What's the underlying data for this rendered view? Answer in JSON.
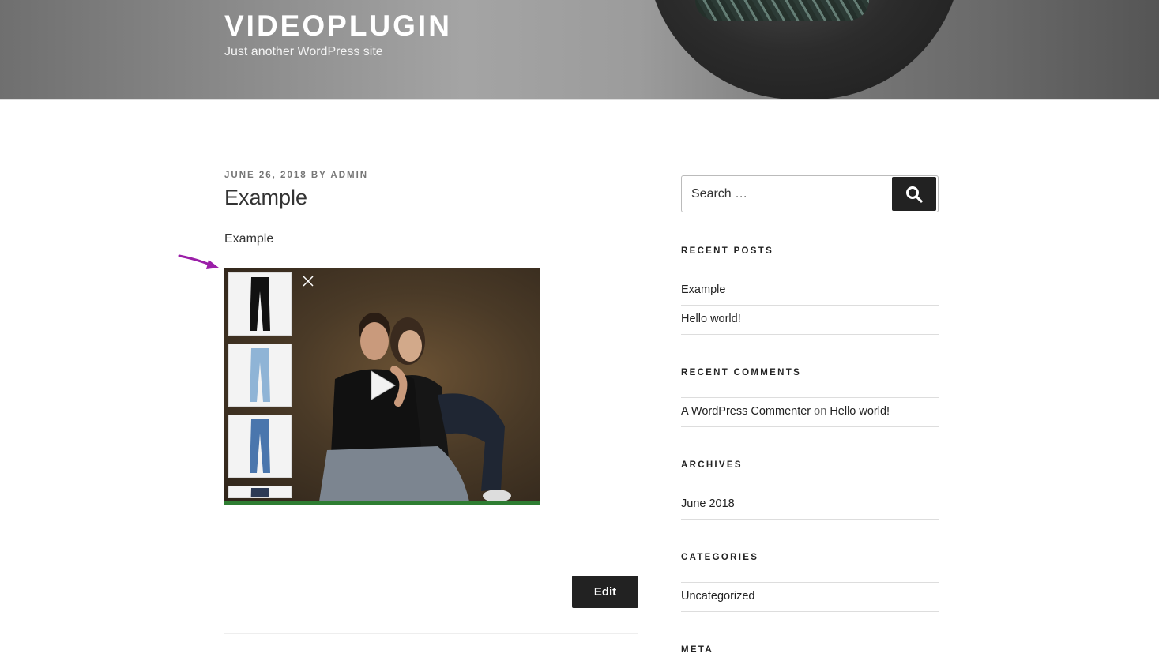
{
  "site": {
    "title": "VIDEOPLUGIN",
    "tagline": "Just another WordPress site"
  },
  "post": {
    "date": "JUNE 26, 2018",
    "by": "BY",
    "author": "ADMIN",
    "title": "Example",
    "content": "Example",
    "edit_label": "Edit",
    "video": {
      "progress_fraction": 1.0,
      "progress_color": "#2e7d32",
      "thumbnails": [
        "black-jeans",
        "light-blue-jeans",
        "medium-blue-jeans",
        "dark-jeans"
      ]
    }
  },
  "annotation": {
    "arrow_color": "#9b1fa8"
  },
  "sidebar": {
    "search": {
      "placeholder": "Search …",
      "button_icon": "search-icon"
    },
    "recent_posts": {
      "title": "RECENT POSTS",
      "items": [
        "Example",
        "Hello world!"
      ]
    },
    "recent_comments": {
      "title": "RECENT COMMENTS",
      "items": [
        {
          "author": "A WordPress Commenter",
          "on": "on",
          "post": "Hello world!"
        }
      ]
    },
    "archives": {
      "title": "ARCHIVES",
      "items": [
        "June 2018"
      ]
    },
    "categories": {
      "title": "CATEGORIES",
      "items": [
        "Uncategorized"
      ]
    },
    "meta": {
      "title": "META"
    }
  }
}
